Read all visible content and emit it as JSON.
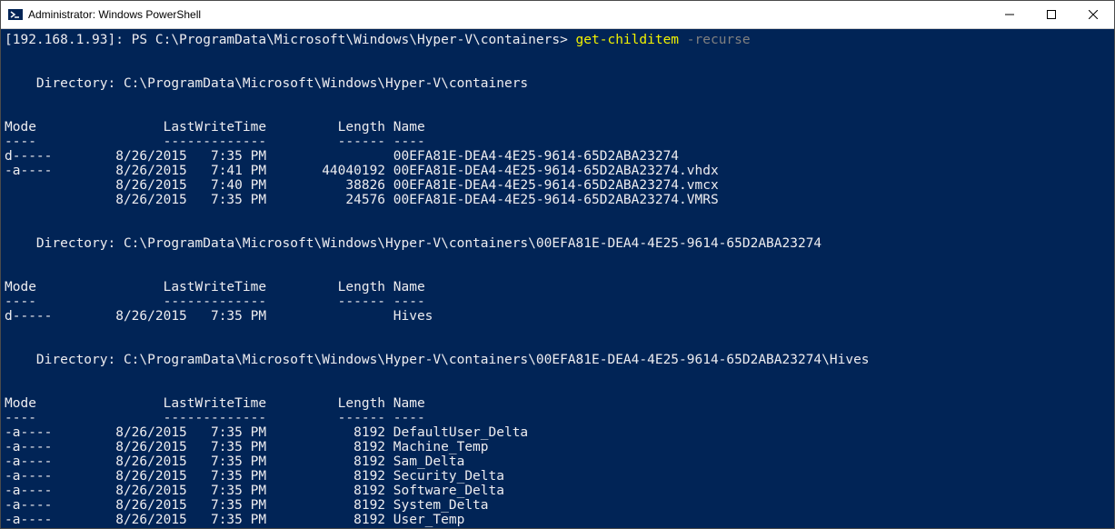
{
  "titlebar": {
    "title": "Administrator: Windows PowerShell"
  },
  "prompt": {
    "host": "[192.168.1.93]: PS C:\\ProgramData\\Microsoft\\Windows\\Hyper-V\\containers> ",
    "cmd": "get-childitem",
    "arg": " -recurse"
  },
  "listings": [
    {
      "dir_label": "    Directory: ",
      "dir_path": "C:\\ProgramData\\Microsoft\\Windows\\Hyper-V\\containers",
      "header": "Mode                LastWriteTime         Length Name",
      "divider": "----                -------------         ------ ----",
      "rows": [
        "d-----        8/26/2015   7:35 PM                00EFA81E-DEA4-4E25-9614-65D2ABA23274",
        "-a----        8/26/2015   7:41 PM       44040192 00EFA81E-DEA4-4E25-9614-65D2ABA23274.vhdx",
        "              8/26/2015   7:40 PM          38826 00EFA81E-DEA4-4E25-9614-65D2ABA23274.vmcx",
        "              8/26/2015   7:35 PM          24576 00EFA81E-DEA4-4E25-9614-65D2ABA23274.VMRS"
      ]
    },
    {
      "dir_label": "    Directory: ",
      "dir_path": "C:\\ProgramData\\Microsoft\\Windows\\Hyper-V\\containers\\00EFA81E-DEA4-4E25-9614-65D2ABA23274",
      "header": "Mode                LastWriteTime         Length Name",
      "divider": "----                -------------         ------ ----",
      "rows": [
        "d-----        8/26/2015   7:35 PM                Hives"
      ]
    },
    {
      "dir_label": "    Directory: ",
      "dir_path": "C:\\ProgramData\\Microsoft\\Windows\\Hyper-V\\containers\\00EFA81E-DEA4-4E25-9614-65D2ABA23274\\Hives",
      "header": "Mode                LastWriteTime         Length Name",
      "divider": "----                -------------         ------ ----",
      "rows": [
        "-a----        8/26/2015   7:35 PM           8192 DefaultUser_Delta",
        "-a----        8/26/2015   7:35 PM           8192 Machine_Temp",
        "-a----        8/26/2015   7:35 PM           8192 Sam_Delta",
        "-a----        8/26/2015   7:35 PM           8192 Security_Delta",
        "-a----        8/26/2015   7:35 PM           8192 Software_Delta",
        "-a----        8/26/2015   7:35 PM           8192 System_Delta",
        "-a----        8/26/2015   7:35 PM           8192 User_Temp"
      ]
    }
  ]
}
